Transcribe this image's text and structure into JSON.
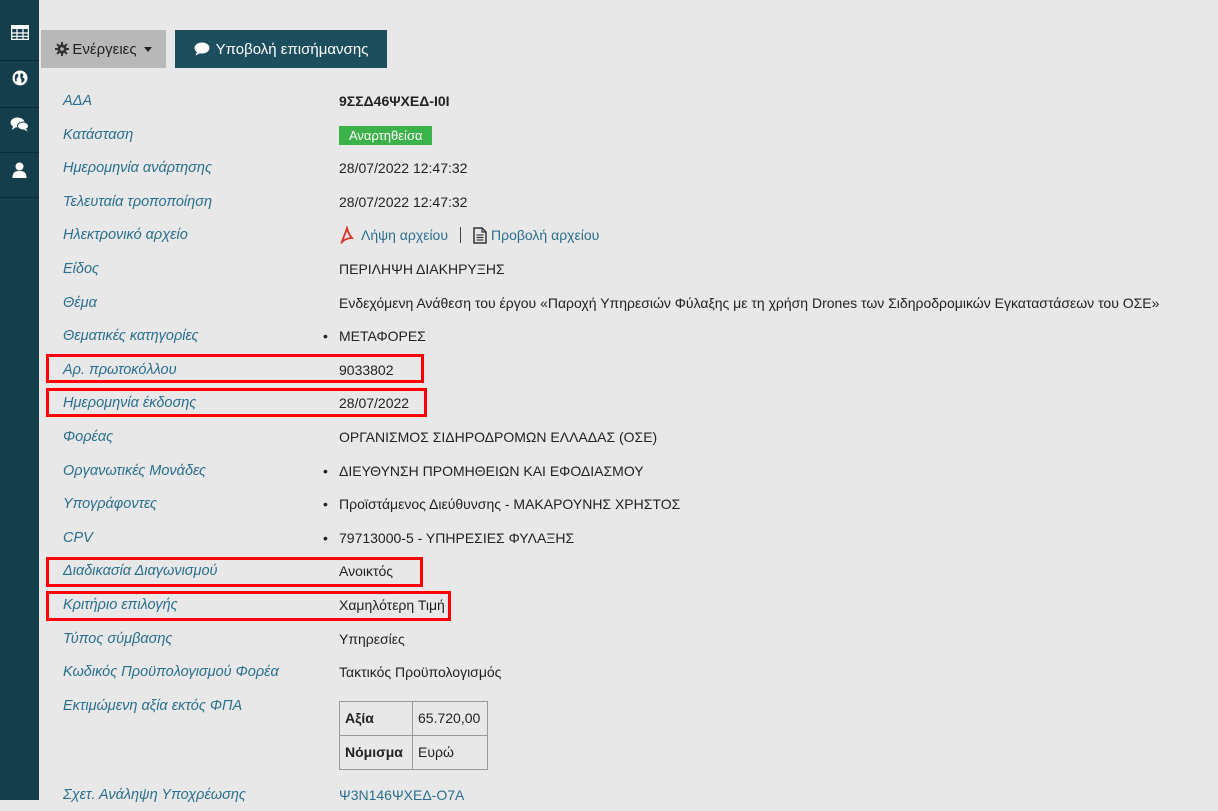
{
  "sidebar": {
    "icons": [
      "table-icon",
      "globe-icon",
      "comments-icon",
      "user-icon"
    ]
  },
  "toolbar": {
    "actions_label": "Ενέργειες",
    "report_label": "Υποβολή επισήμανσης"
  },
  "details": {
    "ada": {
      "label": "ΑΔΑ",
      "value": "9ΣΣΔ46ΨΧΕΔ-Ι0Ι"
    },
    "status": {
      "label": "Κατάσταση",
      "value": "Αναρτηθείσα"
    },
    "published": {
      "label": "Ημερομηνία ανάρτησης",
      "value": "28/07/2022 12:47:32"
    },
    "modified": {
      "label": "Τελευταία τροποποίηση",
      "value": "28/07/2022 12:47:32"
    },
    "file": {
      "label": "Ηλεκτρονικό αρχείο",
      "download": "Λήψη αρχείου",
      "view": "Προβολή αρχείου"
    },
    "type": {
      "label": "Είδος",
      "value": "ΠΕΡΙΛΗΨΗ ΔΙΑΚΗΡΥΞΗΣ"
    },
    "subject": {
      "label": "Θέμα",
      "value": "Ενδεχόμενη Ανάθεση του έργου «Παροχή Υπηρεσιών Φύλαξης με τη χρήση Drones των Σιδηροδρομικών Εγκαταστάσεων του ΟΣΕ»"
    },
    "categories": {
      "label": "Θεματικές κατηγορίες",
      "value": "ΜΕΤΑΦΟΡΕΣ"
    },
    "protocol": {
      "label": "Αρ. πρωτοκόλλου",
      "value": "9033802"
    },
    "issue_date": {
      "label": "Ημερομηνία έκδοσης",
      "value": "28/07/2022"
    },
    "organization": {
      "label": "Φορέας",
      "value": "ΟΡΓΑΝΙΣΜΟΣ ΣΙΔΗΡΟΔΡΟΜΩΝ ΕΛΛΑΔΑΣ (ΟΣΕ)"
    },
    "units": {
      "label": "Οργανωτικές Μονάδες",
      "value": "ΔΙΕΥΘΥΝΣΗ ΠΡΟΜΗΘΕΙΩΝ ΚΑΙ ΕΦΟΔΙΑΣΜΟΥ"
    },
    "signers": {
      "label": "Υπογράφοντες",
      "value": "Προϊστάμενος Διεύθυνσης - ΜΑΚΑΡΟΥΝΗΣ ΧΡΗΣΤΟΣ"
    },
    "cpv": {
      "label": "CPV",
      "value": "79713000-5 - ΥΠΗΡΕΣΙΕΣ ΦΥΛΑΞΗΣ"
    },
    "procedure": {
      "label": "Διαδικασία Διαγωνισμού",
      "value": "Ανοικτός"
    },
    "criterion": {
      "label": "Κριτήριο επιλογής",
      "value": "Χαμηλότερη Τιμή"
    },
    "contract_type": {
      "label": "Τύπος σύμβασης",
      "value": "Υπηρεσίες"
    },
    "budget_code": {
      "label": "Κωδικός Προϋπολογισμού Φορέα",
      "value": "Τακτικός Προϋπολογισμός"
    },
    "estimated_value": {
      "label": "Εκτιμώμενη αξία εκτός ΦΠΑ",
      "amount_header": "Αξία",
      "amount": "65.720,00",
      "currency_header": "Νόμισμα",
      "currency": "Ευρώ"
    },
    "commitment": {
      "label": "Σχετ. Ανάληψη Υποχρέωσης",
      "value": "Ψ3Ν146ΨΧΕΔ-Ο7Α"
    }
  },
  "colors": {
    "sidebar": "#153e4d",
    "label": "#2a6f8e",
    "status_badge": "#3bb34a",
    "highlight": "#ff0000",
    "report_button": "#1d4e5e"
  }
}
